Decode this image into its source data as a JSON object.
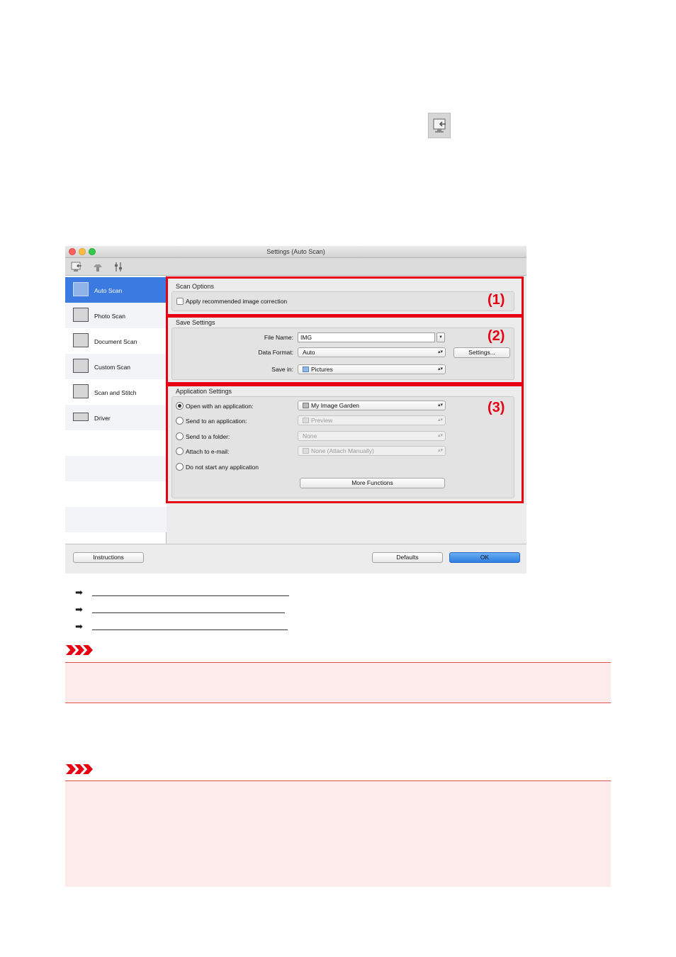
{
  "window": {
    "title": "Settings (Auto Scan)"
  },
  "toolbar": {
    "icons": [
      "scan-from-computer-icon",
      "scan-from-operation-panel-icon",
      "general-settings-icon"
    ]
  },
  "sidebar": {
    "items": [
      {
        "label": "Auto Scan",
        "icon": "auto-scan-icon",
        "selected": true
      },
      {
        "label": "Photo Scan",
        "icon": "photo-scan-icon",
        "selected": false
      },
      {
        "label": "Document Scan",
        "icon": "document-scan-icon",
        "selected": false
      },
      {
        "label": "Custom Scan",
        "icon": "custom-scan-icon",
        "selected": false
      },
      {
        "label": "Scan and Stitch",
        "icon": "scan-and-stitch-icon",
        "selected": false
      },
      {
        "label": "Driver",
        "icon": "driver-icon",
        "selected": false
      }
    ]
  },
  "scan_options": {
    "title": "Scan Options",
    "apply_correction_label": "Apply recommended image correction",
    "apply_correction_checked": false,
    "marker": "(1)"
  },
  "save_settings": {
    "title": "Save Settings",
    "file_name_label": "File Name:",
    "file_name_value": "IMG",
    "data_format_label": "Data Format:",
    "data_format_value": "Auto",
    "settings_button": "Settings...",
    "save_in_label": "Save in:",
    "save_in_value": "Pictures",
    "marker": "(2)"
  },
  "application_settings": {
    "title": "Application Settings",
    "open_with_label": "Open with an application:",
    "open_with_value": "My Image Garden",
    "send_to_app_label": "Send to an application:",
    "send_to_app_value": "Preview",
    "send_to_folder_label": "Send to a folder:",
    "send_to_folder_value": "None",
    "attach_email_label": "Attach to e-mail:",
    "attach_email_value": "None (Attach Manually)",
    "no_app_label": "Do not start any application",
    "selected_option": "open_with",
    "more_functions_button": "More Functions",
    "marker": "(3)"
  },
  "footer": {
    "instructions_button": "Instructions",
    "defaults_button": "Defaults",
    "ok_button": "OK"
  },
  "colors": {
    "highlight_frame": "#e60012",
    "selection_blue": "#3b7ae0",
    "important_background": "#fdebeb"
  }
}
